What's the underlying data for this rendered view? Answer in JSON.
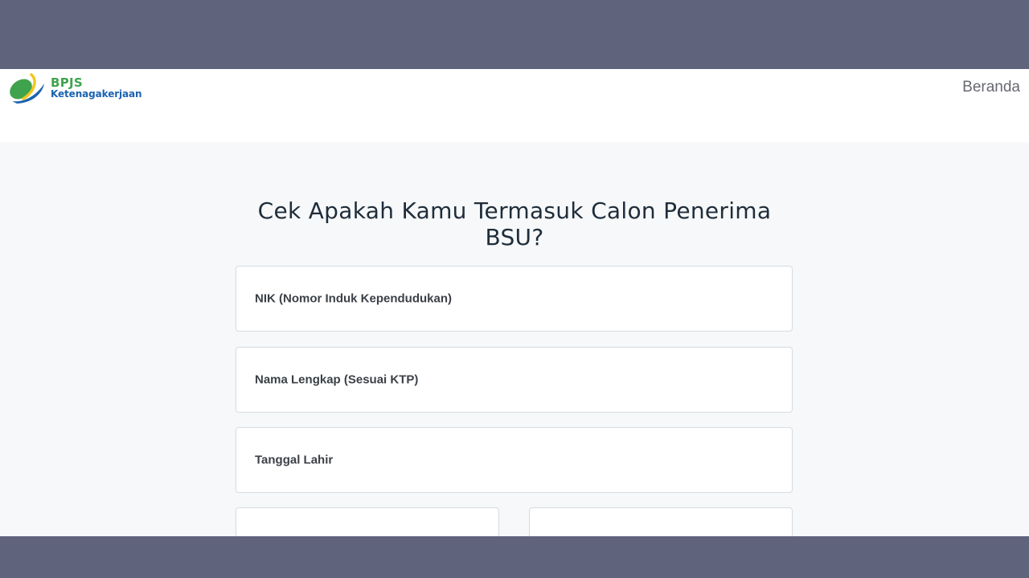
{
  "header": {
    "logo": {
      "line1": "BPJS",
      "line2": "Ketenagakerjaan"
    },
    "nav": {
      "beranda": "Beranda"
    }
  },
  "main": {
    "title": "Cek Apakah Kamu Termasuk Calon Penerima BSU?",
    "fields": {
      "nik": "NIK (Nomor Induk Kependudukan)",
      "nama": "Nama Lengkap (Sesuai KTP)",
      "tanggal_lahir": "Tanggal Lahir"
    }
  },
  "colors": {
    "frame": "#5f637c",
    "page_bg": "#f6f8f9",
    "logo_green": "#3fa34d",
    "logo_blue": "#1b63b1",
    "heading": "#1f2d3a"
  },
  "icons": {
    "logo_mark": "bpjs-logo-icon"
  }
}
